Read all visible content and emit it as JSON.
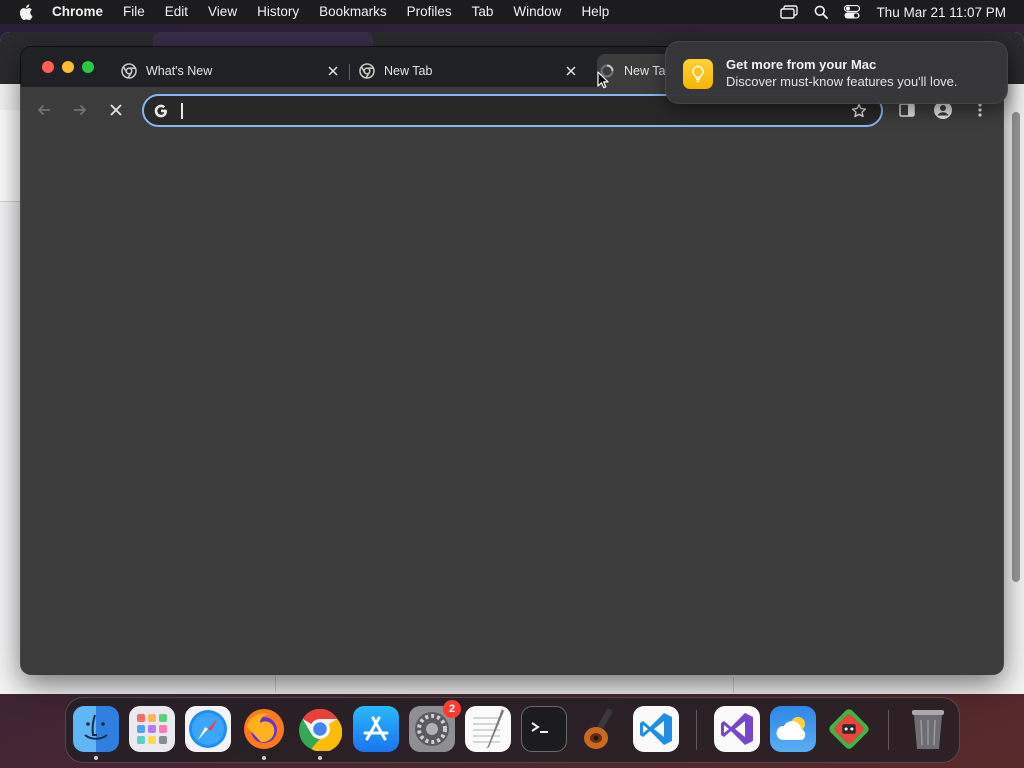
{
  "menubar": {
    "app_name": "Chrome",
    "items": [
      "File",
      "Edit",
      "View",
      "History",
      "Bookmarks",
      "Profiles",
      "Tab",
      "Window",
      "Help"
    ],
    "clock": "Thu Mar 21  11:07 PM"
  },
  "browser": {
    "tabs": [
      {
        "title": "What's New",
        "icon": "chrome-icon"
      },
      {
        "title": "New Tab",
        "icon": "chrome-icon"
      },
      {
        "title": "New Ta",
        "icon": "loading-icon",
        "active": true
      }
    ],
    "omnibox": {
      "value": "",
      "placeholder": ""
    }
  },
  "notification": {
    "title": "Get more from your Mac",
    "body": "Discover must-know features you'll love."
  },
  "dock": {
    "apps": [
      {
        "name": "Finder",
        "running": true
      },
      {
        "name": "Launchpad"
      },
      {
        "name": "Safari"
      },
      {
        "name": "Firefox",
        "running": true
      },
      {
        "name": "Google Chrome",
        "running": true
      },
      {
        "name": "App Store"
      },
      {
        "name": "System Settings",
        "badge": "2"
      },
      {
        "name": "TextEdit"
      },
      {
        "name": "Terminal"
      },
      {
        "name": "GarageBand"
      },
      {
        "name": "Visual Studio Code"
      },
      {
        "name": "Visual Studio"
      },
      {
        "name": "Weather"
      },
      {
        "name": "Game App"
      },
      {
        "name": "Trash"
      }
    ]
  },
  "colors": {
    "accent": "#8ab4f8",
    "window_bg": "#3c3c3c",
    "tabstrip_bg": "#202124"
  }
}
